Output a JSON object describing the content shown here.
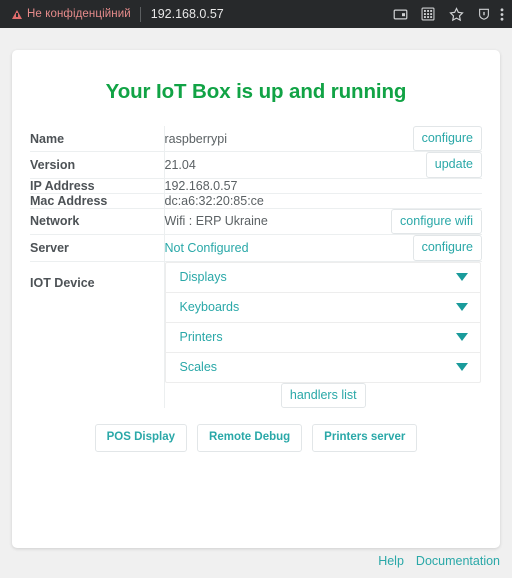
{
  "browser": {
    "security_warning": "Не конфіденційний",
    "url": "192.168.0.57",
    "icons": [
      "cast-icon",
      "qr-code-icon",
      "star-bookmark-icon",
      "shield-icon",
      "menu-icon"
    ]
  },
  "page": {
    "title": "Your IoT Box is up and running",
    "title_color": "#11a345",
    "accent_color": "#2aa8a8"
  },
  "info_rows": [
    {
      "label": "Name",
      "value": "raspberrypi",
      "action": "configure",
      "is_link": false
    },
    {
      "label": "Version",
      "value": "21.04",
      "action": "update",
      "is_link": false
    },
    {
      "label": "IP Address",
      "value": "192.168.0.57",
      "action": "",
      "is_link": false
    },
    {
      "label": "Mac Address",
      "value": "dc:a6:32:20:85:ce",
      "action": "",
      "is_link": false
    },
    {
      "label": "Network",
      "value": "Wifi : ERP Ukraine",
      "action": "configure wifi",
      "is_link": false
    },
    {
      "label": "Server",
      "value": "Not Configured",
      "action": "configure",
      "is_link": true
    }
  ],
  "iot_device": {
    "label": "IOT Device",
    "items": [
      {
        "label": "Displays",
        "caret": "chevron-down-icon"
      },
      {
        "label": "Keyboards",
        "caret": "chevron-down-icon"
      },
      {
        "label": "Printers",
        "caret": "chevron-down-icon"
      },
      {
        "label": "Scales",
        "caret": "chevron-down-icon"
      }
    ],
    "handlers_button": "handlers list"
  },
  "bottom_buttons": [
    {
      "label": "POS Display"
    },
    {
      "label": "Remote Debug"
    },
    {
      "label": "Printers server"
    }
  ],
  "footer": {
    "help": "Help",
    "documentation": "Documentation"
  }
}
